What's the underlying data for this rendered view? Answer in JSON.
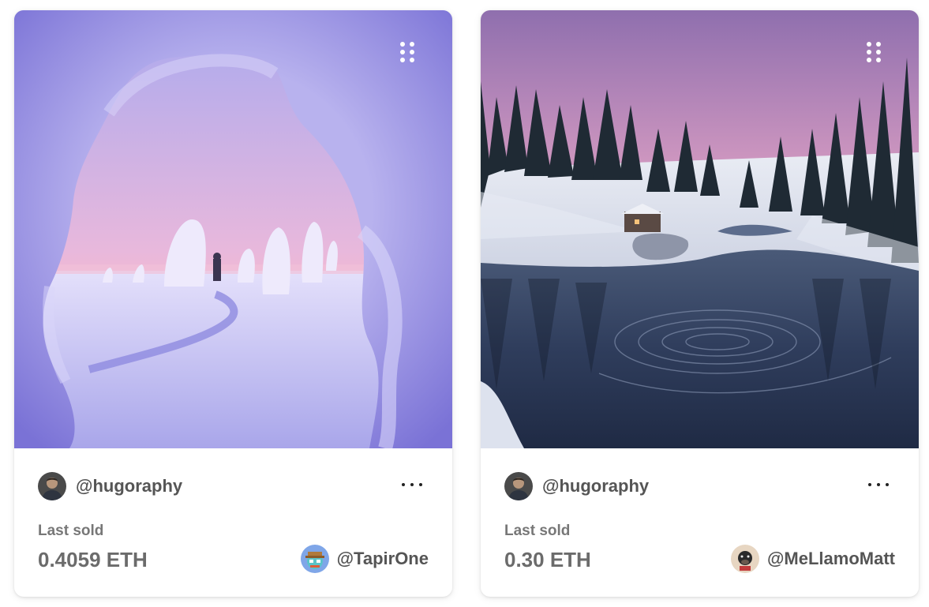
{
  "cards": [
    {
      "creator": {
        "handle": "@hugoraphy"
      },
      "last_sold_label": "Last sold",
      "price": "0.4059 ETH",
      "owner": {
        "handle": "@TapirOne"
      }
    },
    {
      "creator": {
        "handle": "@hugoraphy"
      },
      "last_sold_label": "Last sold",
      "price": "0.30 ETH",
      "owner": {
        "handle": "@MeLlamoMatt"
      }
    }
  ],
  "icons": {
    "media_menu": "grid-dots-icon",
    "card_menu": "more-horizontal-icon"
  },
  "colors": {
    "card_background": "#ffffff",
    "text_primary": "#555555",
    "text_muted": "#777777"
  }
}
